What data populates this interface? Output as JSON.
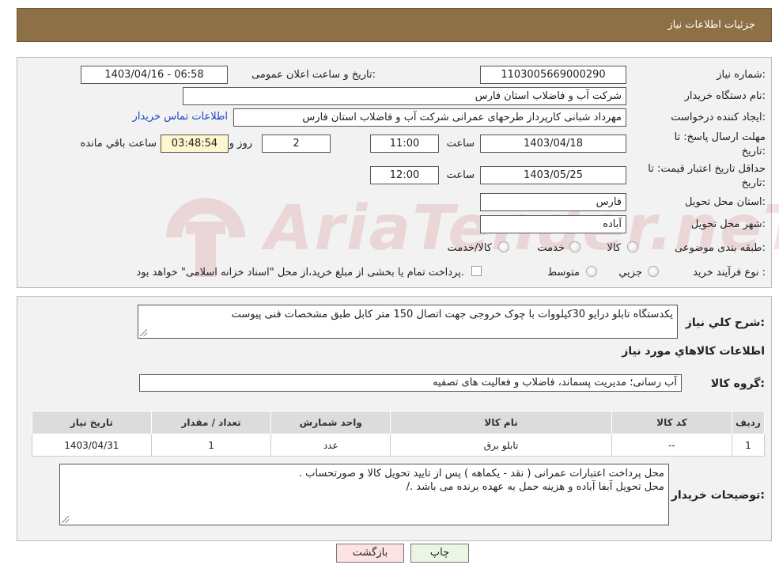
{
  "header": {
    "title": "جزئیات اطلاعات نیاز"
  },
  "form": {
    "need_number_label": "شماره نیاز:",
    "need_number": "1103005669000290",
    "announce_label": "تاریخ و ساعت اعلان عمومی:",
    "announce_value": "1403/04/16 - 06:58",
    "buyer_org_label": "نام دستگاه خریدار:",
    "buyer_org": "شرکت آب و فاضلاب استان فارس",
    "creator_label": "ایجاد کننده درخواست:",
    "creator": "مهرداد شبانی کارپرداز طرحهای عمرانی  شرکت آب و فاضلاب استان فارس",
    "contact_link": "اطلاعات تماس خریدار",
    "deadline_label_1": "مهلت ارسال پاسخ: تا",
    "deadline_label_2": "تاریخ:",
    "deadline_date": "1403/04/18",
    "time_label": "ساعت",
    "deadline_time": "11:00",
    "days_value": "2",
    "days_label": "روز و",
    "remaining_time": "03:48:54",
    "remaining_label": "ساعت باقي مانده",
    "validity_label_1": "حداقل تاریخ اعتبار قیمت: تا",
    "validity_label_2": "تاریخ:",
    "validity_date": "1403/05/25",
    "validity_time_label": "ساعت",
    "validity_time": "12:00",
    "province_label": "استان محل تحویل:",
    "province": "فارس",
    "city_label": "شهر محل تحویل:",
    "city": "آباده",
    "category_label": "طبقه بندی موضوعی:",
    "category_options": [
      "کالا",
      "خدمت",
      "کالا/خدمت"
    ],
    "process_label": "نوع فرآیند خرید :",
    "process_options": [
      "جزيي",
      "متوسط"
    ],
    "payment_note": "پرداخت تمام یا بخشی از مبلغ خرید،از محل \"اسناد خزانه اسلامی\" خواهد بود."
  },
  "watermark": {
    "text": "AriaTender.neT"
  },
  "details": {
    "summary_label": "شرح کلي نياز:",
    "summary": "یکدستگاه تابلو درایو 30کیلووات با چوک خروجی جهت اتصال 150 متر کابل طبق مشخصات فنی پیوست",
    "goods_info_title": "اطلاعات کالاهاي مورد نياز",
    "group_label": "گروه کالا:",
    "group": "آب رسانی؛ مدیریت پسماند، فاضلاب و فعالیت های تصفیه",
    "table": {
      "headers": [
        "رديف",
        "کد کالا",
        "نام کالا",
        "واحد شمارش",
        "تعداد / مقدار",
        "تاریخ نیاز"
      ],
      "rows": [
        [
          "1",
          "--",
          "تابلو برق",
          "عدد",
          "1",
          "1403/04/31"
        ]
      ]
    },
    "buyer_notes_label": "توضیحات خریدار:",
    "buyer_notes_line1": "محل پرداخت اعتبارات عمرانی  ( نقد -  یکماهه ) پس از تایید تحویل کالا و صورتحساب .",
    "buyer_notes_line2": "محل تحویل آبفا آباده  و هزینه حمل به عهده برنده می باشد ./"
  },
  "buttons": {
    "back": "بازگشت",
    "print": "چاپ"
  }
}
